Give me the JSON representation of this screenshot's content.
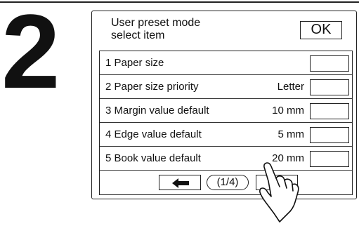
{
  "step_number": "2",
  "panel": {
    "title_line1": "User preset mode",
    "title_line2": "select item",
    "ok_label": "OK"
  },
  "items": [
    {
      "label": "1 Paper size",
      "value": ""
    },
    {
      "label": "2 Paper size priority",
      "value": "Letter"
    },
    {
      "label": "3 Margin value default",
      "value": "10 mm"
    },
    {
      "label": "4 Edge value default",
      "value": "5 mm"
    },
    {
      "label": "5 Book value default",
      "value": "20 mm"
    }
  ],
  "nav": {
    "page_indicator": "(1/4)",
    "prev_icon": "arrow-left-icon",
    "next_icon": "arrow-right-icon"
  },
  "pointer_icon": "pointing-hand-icon"
}
